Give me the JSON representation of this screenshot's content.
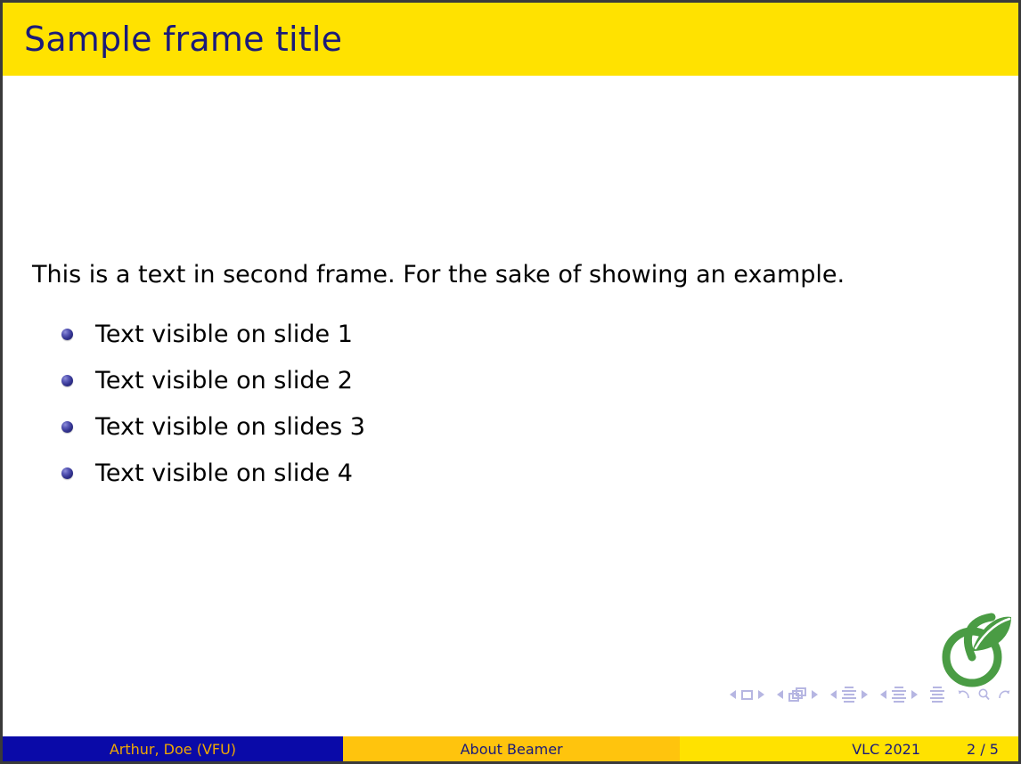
{
  "slide": {
    "frame_title": "Sample frame title",
    "lead_paragraph": "This is a text in second frame.  For the sake of showing an example.",
    "bullets": [
      {
        "label": "Text visible on slide 1"
      },
      {
        "label": "Text visible on slide 2"
      },
      {
        "label": "Text visible on slides 3"
      },
      {
        "label": "Text visible on slide 4"
      }
    ]
  },
  "footer": {
    "author": "Arthur, Doe  (VFU)",
    "short_title": "About Beamer",
    "event": "VLC 2021",
    "page": "2 / 5"
  },
  "navigation": {
    "slide_prev_icon": "triangle-left-icon",
    "slide_icon": "slide-square-icon",
    "slide_next_icon": "triangle-right-icon",
    "frame_prev_icon": "triangle-left-icon",
    "frame_icon": "frame-stack-icon",
    "frame_next_icon": "triangle-right-icon",
    "subsection_prev_icon": "triangle-left-icon",
    "subsection_icon": "subsection-lines-icon",
    "subsection_next_icon": "triangle-right-icon",
    "section_prev_icon": "triangle-left-icon",
    "section_icon": "section-lines-icon",
    "section_next_icon": "triangle-right-icon",
    "presentation_icon": "presentation-lines-icon",
    "back_icon": "undo-arrow-icon",
    "search_icon": "magnifier-icon",
    "forward_icon": "redo-arrow-icon"
  },
  "logo": {
    "name": "green-fruit-leaf-logo"
  },
  "colors": {
    "title_bar": "#ffe200",
    "title_text": "#1a1a7a",
    "body_text": "#000000",
    "bullet": "#33338f",
    "footer_author_bg": "#0a0aa8",
    "footer_author_text": "#f0a800",
    "footer_title_bg": "#ffc40d",
    "footer_info_bg": "#ffe200",
    "footer_text": "#1a1a7a",
    "nav_symbols": "#b6b6e2",
    "logo_green": "#4a9c44",
    "frame_border": "#3a3a3a"
  }
}
